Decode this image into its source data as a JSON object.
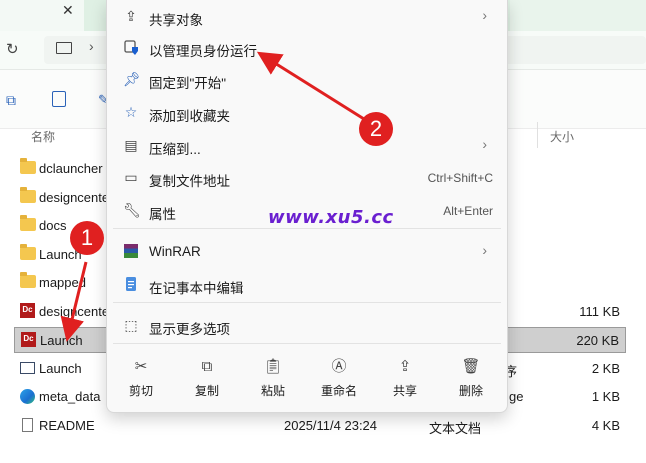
{
  "explorer": {
    "columns": {
      "name": "名称",
      "size": "大小"
    },
    "rows": [
      {
        "name": "dclauncher",
        "icon": "folder-icon",
        "date": "",
        "type": "",
        "size": ""
      },
      {
        "name": "designcente",
        "icon": "folder-icon",
        "date": "",
        "type": "",
        "size": ""
      },
      {
        "name": "docs",
        "icon": "folder-icon",
        "date": "",
        "type": "",
        "size": ""
      },
      {
        "name": "Launch",
        "icon": "folder-icon",
        "date": "",
        "type": "",
        "size": ""
      },
      {
        "name": "mapped",
        "icon": "folder-icon",
        "date": "",
        "type": "",
        "size": ""
      },
      {
        "name": "designcente",
        "icon": "dc-app-icon",
        "date": "",
        "type": "",
        "size": "111 KB"
      },
      {
        "name": "Launch",
        "icon": "dc-app-icon",
        "date": "",
        "type": "",
        "size": "220 KB",
        "selected": true
      },
      {
        "name": "Launch",
        "icon": "exe-icon",
        "date": "",
        "type": "序",
        "size": "2 KB"
      },
      {
        "name": "meta_data",
        "icon": "edge-icon",
        "date": "",
        "type": "ge",
        "size": "1 KB"
      },
      {
        "name": "README",
        "icon": "document-icon",
        "date": "2025/11/4 23:24",
        "type": "文本文档",
        "size": "4 KB"
      }
    ]
  },
  "context_menu": {
    "items": [
      {
        "label": "共享对象",
        "icon": "share-icon",
        "shortcut": "",
        "arrow": true
      },
      {
        "label": "以管理员身份运行",
        "icon": "shield-icon",
        "shortcut": "",
        "arrow": false
      },
      {
        "label": "固定到\"开始\"",
        "icon": "pin-icon",
        "shortcut": "",
        "arrow": false
      },
      {
        "label": "添加到收藏夹",
        "icon": "star-icon",
        "shortcut": "",
        "arrow": false
      },
      {
        "label": "压缩到...",
        "icon": "zip-icon",
        "shortcut": "",
        "arrow": true
      },
      {
        "label": "复制文件地址",
        "icon": "copy-path-icon",
        "shortcut": "Ctrl+Shift+C",
        "arrow": false
      },
      {
        "label": "属性",
        "icon": "wrench-icon",
        "shortcut": "Alt+Enter",
        "arrow": false
      },
      {
        "label": "WinRAR",
        "icon": "winrar-icon",
        "shortcut": "",
        "arrow": true
      },
      {
        "label": "在记事本中编辑",
        "icon": "notepad-icon",
        "shortcut": "",
        "arrow": false
      },
      {
        "label": "显示更多选项",
        "icon": "more-options-icon",
        "shortcut": "",
        "arrow": false
      }
    ],
    "quick_actions": [
      {
        "label": "剪切",
        "icon": "cut-icon"
      },
      {
        "label": "复制",
        "icon": "copy-icon"
      },
      {
        "label": "粘贴",
        "icon": "paste-icon"
      },
      {
        "label": "重命名",
        "icon": "rename-icon"
      },
      {
        "label": "共享",
        "icon": "share-icon"
      },
      {
        "label": "删除",
        "icon": "delete-icon"
      }
    ]
  },
  "annotations": {
    "watermark": "www.xu5.cc",
    "badge1": "1",
    "badge2": "2"
  },
  "colors": {
    "accent_red": "#e02020",
    "watermark": "#6a1fd0",
    "selection": "#cfcfcf"
  }
}
